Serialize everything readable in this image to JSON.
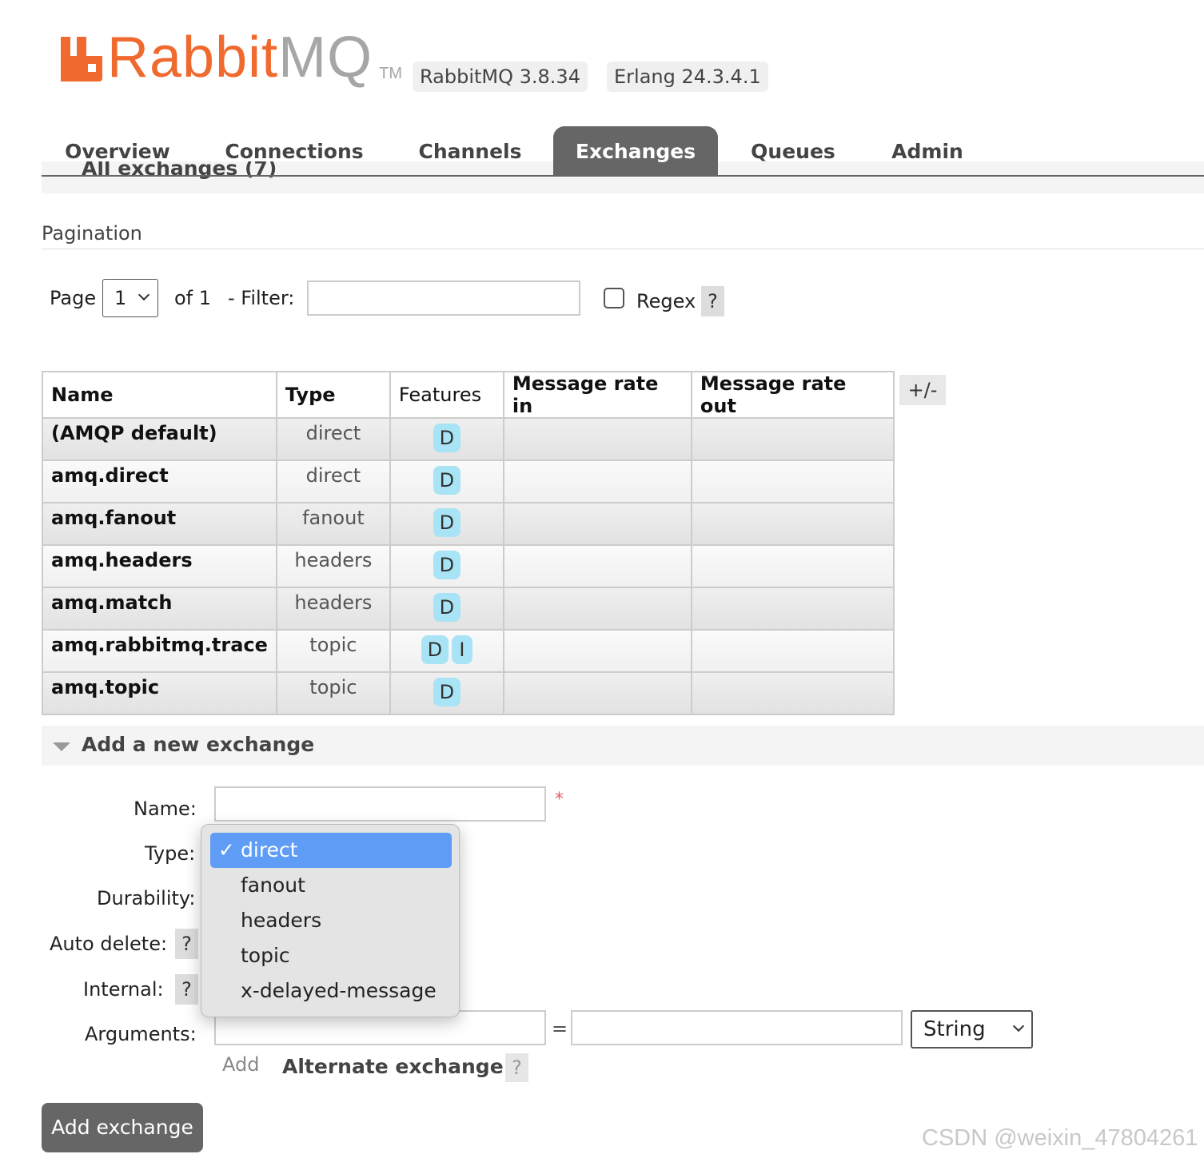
{
  "brand": {
    "logo_main": "Rabbit",
    "logo_accent": "MQ",
    "logo_tm": "TM",
    "version_badge": "RabbitMQ 3.8.34",
    "erlang_badge": "Erlang 24.3.4.1",
    "brand_color": "#f06a2f"
  },
  "nav": {
    "tabs": [
      "Overview",
      "Connections",
      "Channels",
      "Exchanges",
      "Queues",
      "Admin"
    ],
    "active": "Exchanges",
    "hidden_heading": "All exchanges (7)"
  },
  "pagination": {
    "section_label": "Pagination",
    "page_label": "Page",
    "page_value": "1",
    "of_label": "of 1",
    "filter_label": "- Filter:",
    "filter_value": "",
    "regex_label": "Regex",
    "regex_checked": false,
    "help": "?"
  },
  "table": {
    "columns": [
      "Name",
      "Type",
      "Features",
      "Message rate in",
      "Message rate out"
    ],
    "toggle": "+/-",
    "rows": [
      {
        "name": "(AMQP default)",
        "type": "direct",
        "features": [
          "D"
        ]
      },
      {
        "name": "amq.direct",
        "type": "direct",
        "features": [
          "D"
        ]
      },
      {
        "name": "amq.fanout",
        "type": "fanout",
        "features": [
          "D"
        ]
      },
      {
        "name": "amq.headers",
        "type": "headers",
        "features": [
          "D"
        ]
      },
      {
        "name": "amq.match",
        "type": "headers",
        "features": [
          "D"
        ]
      },
      {
        "name": "amq.rabbitmq.trace",
        "type": "topic",
        "features": [
          "D",
          "I"
        ]
      },
      {
        "name": "amq.topic",
        "type": "topic",
        "features": [
          "D"
        ]
      }
    ]
  },
  "add_exchange": {
    "title": "Add a new exchange",
    "name_label": "Name:",
    "name_value": "",
    "required_mark": "*",
    "type_label": "Type:",
    "durability_label": "Durability:",
    "auto_delete_label": "Auto delete:",
    "internal_label": "Internal:",
    "arguments_label": "Arguments:",
    "help": "?",
    "eq": "=",
    "arg_type": "String",
    "add_link": "Add",
    "alternate_exchange": "Alternate exchange",
    "submit": "Add exchange"
  },
  "type_dropdown": {
    "check": "✓",
    "selected": "direct",
    "options": [
      "direct",
      "fanout",
      "headers",
      "topic",
      "x-delayed-message"
    ]
  },
  "watermark": "CSDN @weixin_47804261"
}
